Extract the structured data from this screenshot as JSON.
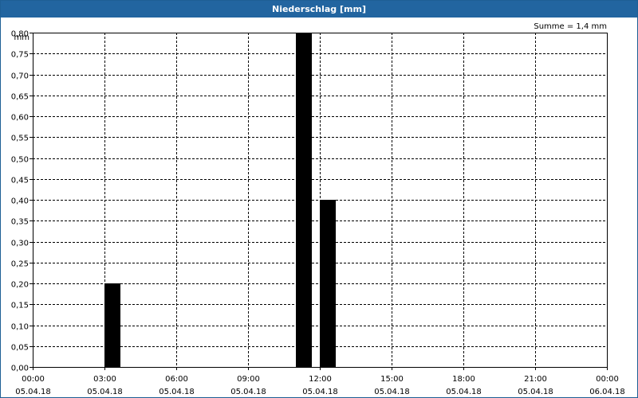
{
  "window": {
    "title": "Niederschlag [mm]"
  },
  "colors": {
    "titlebar": "#2265a0",
    "bar": "#000000",
    "grid": "#000000"
  },
  "chart_data": {
    "type": "bar",
    "title": "Niederschlag [mm]",
    "ylabel": "mm",
    "sum_label": "Summe = 1,4 mm",
    "ylim": [
      0,
      0.8
    ],
    "y_ticks": [
      0,
      0.05,
      0.1,
      0.15,
      0.2,
      0.25,
      0.3,
      0.35,
      0.4,
      0.45,
      0.5,
      0.55,
      0.6,
      0.65,
      0.7,
      0.75,
      0.8
    ],
    "y_tick_labels": [
      "0,00",
      "0,05",
      "0,10",
      "0,15",
      "0,20",
      "0,25",
      "0,30",
      "0,35",
      "0,40",
      "0,45",
      "0,50",
      "0,55",
      "0,60",
      "0,65",
      "0,70",
      "0,75",
      "0,80"
    ],
    "x_range_hours": [
      0,
      24
    ],
    "x_ticks": [
      {
        "hour": 0,
        "time": "00:00",
        "date": "05.04.18"
      },
      {
        "hour": 3,
        "time": "03:00",
        "date": "05.04.18"
      },
      {
        "hour": 6,
        "time": "06:00",
        "date": "05.04.18"
      },
      {
        "hour": 9,
        "time": "09:00",
        "date": "05.04.18"
      },
      {
        "hour": 12,
        "time": "12:00",
        "date": "05.04.18"
      },
      {
        "hour": 15,
        "time": "15:00",
        "date": "05.04.18"
      },
      {
        "hour": 18,
        "time": "18:00",
        "date": "05.04.18"
      },
      {
        "hour": 21,
        "time": "21:00",
        "date": "05.04.18"
      },
      {
        "hour": 24,
        "time": "00:00",
        "date": "06.04.18"
      }
    ],
    "bars": [
      {
        "start_hour": 3,
        "end_hour": 3.67,
        "value": 0.2
      },
      {
        "start_hour": 11,
        "end_hour": 11.67,
        "value": 0.8
      },
      {
        "start_hour": 12,
        "end_hour": 12.67,
        "value": 0.4
      }
    ],
    "grid": true
  }
}
